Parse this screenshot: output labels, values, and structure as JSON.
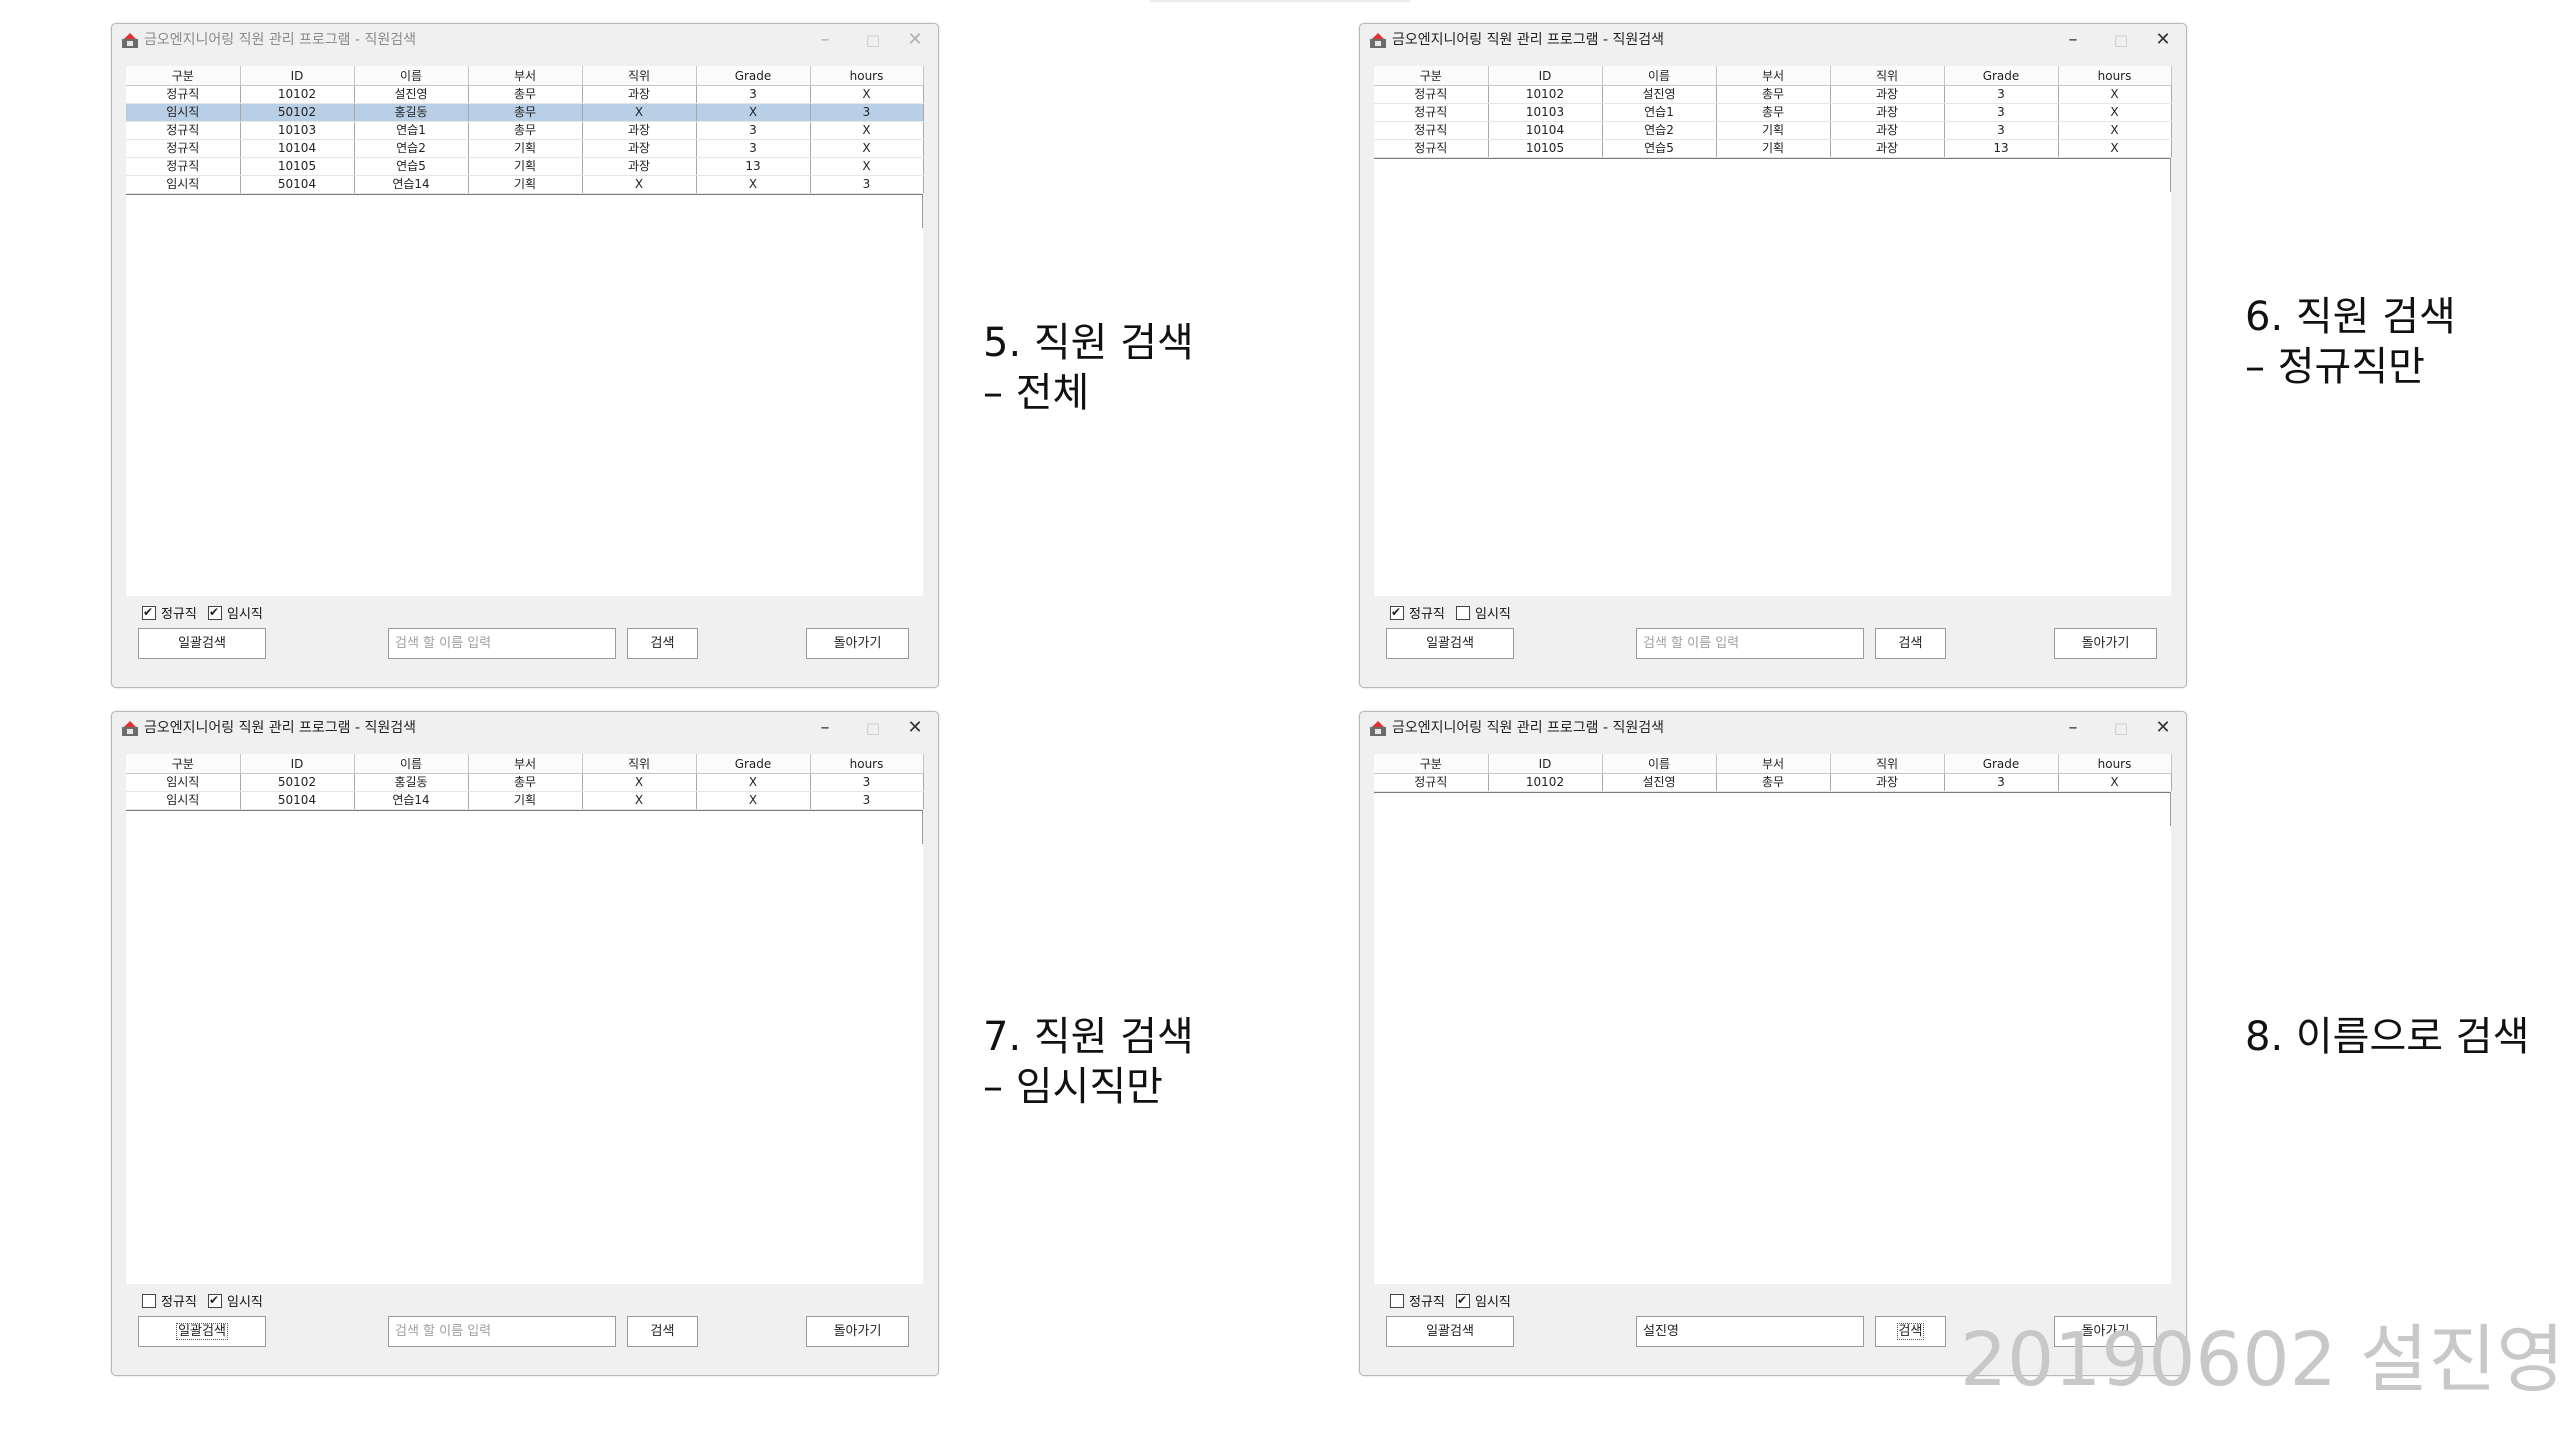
{
  "columns": [
    "구분",
    "ID",
    "이름",
    "부서",
    "직위",
    "Grade",
    "hours"
  ],
  "windows": [
    {
      "title": "금오엔지니어링 직원 관리 프로그램 - 직원검색",
      "active": false,
      "caption": "5. 직원 검색\n– 전체",
      "rows": [
        [
          "정규직",
          "10102",
          "설진영",
          "총무",
          "과장",
          "3",
          "X"
        ],
        [
          "임시직",
          "50102",
          "홍길동",
          "총무",
          "X",
          "X",
          "3"
        ],
        [
          "정규직",
          "10103",
          "연습1",
          "총무",
          "과장",
          "3",
          "X"
        ],
        [
          "정규직",
          "10104",
          "연습2",
          "기획",
          "과장",
          "3",
          "X"
        ],
        [
          "정규직",
          "10105",
          "연습5",
          "기획",
          "과장",
          "13",
          "X"
        ],
        [
          "임시직",
          "50104",
          "연습14",
          "기획",
          "X",
          "X",
          "3"
        ]
      ],
      "selected_row": 1,
      "check_regular": {
        "label": "정규직",
        "checked": true
      },
      "check_temp": {
        "label": "임시직",
        "checked": true
      },
      "search_all_label": "일괄검색",
      "search_input": {
        "value": "",
        "placeholder": "검색 할 이름 입력"
      },
      "search_label": "검색",
      "back_label": "돌아가기",
      "focus": ""
    },
    {
      "title": "금오엔지니어링 직원 관리 프로그램 - 직원검색",
      "active": true,
      "caption": "6. 직원 검색\n– 정규직만",
      "rows": [
        [
          "정규직",
          "10102",
          "설진영",
          "총무",
          "과장",
          "3",
          "X"
        ],
        [
          "정규직",
          "10103",
          "연습1",
          "총무",
          "과장",
          "3",
          "X"
        ],
        [
          "정규직",
          "10104",
          "연습2",
          "기획",
          "과장",
          "3",
          "X"
        ],
        [
          "정규직",
          "10105",
          "연습5",
          "기획",
          "과장",
          "13",
          "X"
        ]
      ],
      "selected_row": -1,
      "check_regular": {
        "label": "정규직",
        "checked": true
      },
      "check_temp": {
        "label": "임시직",
        "checked": false
      },
      "search_all_label": "일괄검색",
      "search_input": {
        "value": "",
        "placeholder": "검색 할 이름 입력"
      },
      "search_label": "검색",
      "back_label": "돌아가기",
      "focus": ""
    },
    {
      "title": "금오엔지니어링 직원 관리 프로그램 - 직원검색",
      "active": true,
      "caption": "7. 직원 검색\n– 임시직만",
      "rows": [
        [
          "임시직",
          "50102",
          "홍길동",
          "총무",
          "X",
          "X",
          "3"
        ],
        [
          "임시직",
          "50104",
          "연습14",
          "기획",
          "X",
          "X",
          "3"
        ]
      ],
      "selected_row": -1,
      "check_regular": {
        "label": "정규직",
        "checked": false
      },
      "check_temp": {
        "label": "임시직",
        "checked": true
      },
      "search_all_label": "일괄검색",
      "search_input": {
        "value": "",
        "placeholder": "검색 할 이름 입력"
      },
      "search_label": "검색",
      "back_label": "돌아가기",
      "focus": "search_all"
    },
    {
      "title": "금오엔지니어링 직원 관리 프로그램 - 직원검색",
      "active": true,
      "caption": "8. 이름으로 검색",
      "rows": [
        [
          "정규직",
          "10102",
          "설진영",
          "총무",
          "과장",
          "3",
          "X"
        ]
      ],
      "selected_row": -1,
      "check_regular": {
        "label": "정규직",
        "checked": false
      },
      "check_temp": {
        "label": "임시직",
        "checked": true
      },
      "search_all_label": "일괄검색",
      "search_input": {
        "value": "설진영",
        "placeholder": "검색 할 이름 입력"
      },
      "search_label": "검색",
      "back_label": "돌아가기",
      "focus": "search"
    }
  ],
  "watermark": "20190602 설진영"
}
